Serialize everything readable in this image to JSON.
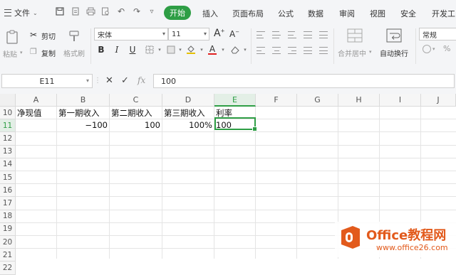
{
  "menu": {
    "file_label": "文件",
    "tabs": [
      "开始",
      "插入",
      "页面布局",
      "公式",
      "数据",
      "审阅",
      "视图",
      "安全",
      "开发工"
    ],
    "active_tab": "开始"
  },
  "ribbon": {
    "paste": "粘贴",
    "cut": "剪切",
    "copy": "复制",
    "format_painter": "格式刷",
    "font_name": "宋体",
    "font_size": "11",
    "bold": "B",
    "italic": "I",
    "underline": "U",
    "increase_font": "A",
    "decrease_font": "A",
    "font_color": "A",
    "merge_center": "合并居中",
    "wrap_text": "自动换行",
    "number_format": "常规"
  },
  "formula_bar": {
    "name_box": "E11",
    "fx": "fx",
    "value": "100"
  },
  "sheet": {
    "columns": [
      "A",
      "B",
      "C",
      "D",
      "E",
      "F",
      "G",
      "H",
      "I",
      "J"
    ],
    "rows": [
      "10",
      "11",
      "12",
      "13",
      "14",
      "15",
      "16",
      "17",
      "18",
      "19",
      "20",
      "21",
      "22"
    ],
    "selected_column": "E",
    "selected_row": "11",
    "row10": {
      "A": "净现值",
      "B": "第一期收入",
      "C": "第二期收入",
      "D": "第三期收入",
      "E": "利率"
    },
    "row11": {
      "B": "−100",
      "C": "100",
      "D": "100%",
      "E": "100"
    }
  },
  "watermark": {
    "title": "Office教程网",
    "url": "www.office26.com",
    "accent": "#e25a1c"
  },
  "colors": {
    "accent": "#2e9e45",
    "ribbon_bg": "#f4f5f7"
  }
}
